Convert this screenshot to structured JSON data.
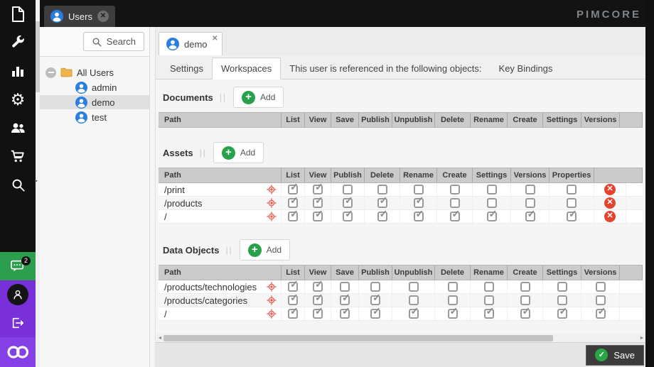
{
  "brand": {
    "logo_text": "PIMCORE"
  },
  "colors": {
    "rail_green": "#2c9e4e",
    "rail_purple": "#7a30d8",
    "user_blue": "#2a7de1",
    "alert_red": "#e2442e",
    "save_green": "#27a844",
    "header_gray": "#cbcbcb"
  },
  "top_bar": {
    "users_tab_label": "Users"
  },
  "left_rail": {
    "icons": [
      "file-icon",
      "wrench-icon",
      "bar-chart-icon",
      "gear-icon",
      "users-icon",
      "cart-icon",
      "search-icon",
      "chat-icon",
      "person-icon",
      "logout-icon",
      "pimcore-logo"
    ],
    "chat_badge": "2"
  },
  "tree_panel": {
    "search_label": "Search",
    "root_label": "All Users",
    "users": [
      "admin",
      "demo",
      "test"
    ],
    "selected_user": "demo"
  },
  "main": {
    "doc_tab": {
      "label": "demo",
      "close_glyph": "✕"
    },
    "tabs": [
      {
        "label": "Settings",
        "active": false
      },
      {
        "label": "Workspaces",
        "active": true
      },
      {
        "label": "This user is referenced in the following objects:",
        "active": false
      },
      {
        "label": "Key Bindings",
        "active": false
      }
    ],
    "sections": [
      {
        "title": "Documents",
        "add_label": "Add",
        "columns": [
          "Path",
          "List",
          "View",
          "Save",
          "Publish",
          "Unpublish",
          "Delete",
          "Rename",
          "Create",
          "Settings",
          "Versions"
        ],
        "has_delete_col": false,
        "rows": []
      },
      {
        "title": "Assets",
        "add_label": "Add",
        "columns": [
          "Path",
          "List",
          "View",
          "Publish",
          "Delete",
          "Rename",
          "Create",
          "Settings",
          "Versions",
          "Properties"
        ],
        "has_delete_col": true,
        "rows": [
          {
            "path": "/print",
            "checks": [
              1,
              1,
              0,
              0,
              0,
              0,
              0,
              0,
              0
            ]
          },
          {
            "path": "/products",
            "checks": [
              1,
              1,
              1,
              1,
              1,
              0,
              0,
              0,
              0
            ]
          },
          {
            "path": "/",
            "checks": [
              1,
              1,
              1,
              1,
              1,
              1,
              1,
              1,
              1
            ]
          }
        ]
      },
      {
        "title": "Data Objects",
        "add_label": "Add",
        "columns": [
          "Path",
          "List",
          "View",
          "Save",
          "Publish",
          "Unpublish",
          "Delete",
          "Rename",
          "Create",
          "Settings",
          "Versions"
        ],
        "has_delete_col": false,
        "rows": [
          {
            "path": "/products/technologies",
            "checks": [
              1,
              1,
              0,
              0,
              0,
              0,
              0,
              0,
              0,
              0
            ]
          },
          {
            "path": "/products/categories",
            "checks": [
              1,
              1,
              1,
              1,
              0,
              0,
              0,
              0,
              0,
              0
            ]
          },
          {
            "path": "/",
            "checks": [
              1,
              1,
              1,
              1,
              1,
              1,
              1,
              1,
              1,
              1
            ]
          }
        ]
      }
    ]
  },
  "footer": {
    "save_label": "Save"
  }
}
